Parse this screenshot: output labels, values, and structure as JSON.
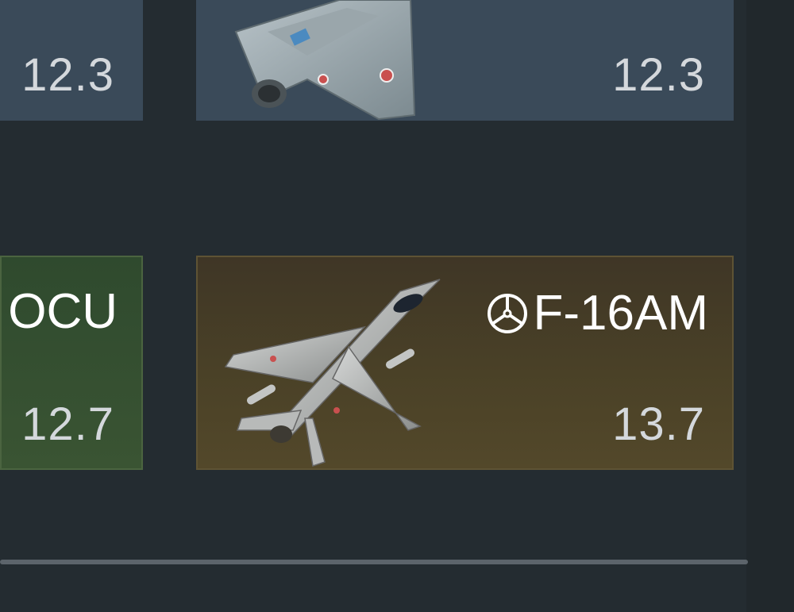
{
  "vehicles": [
    {
      "name": "",
      "br": "12.3",
      "type": "researchable"
    },
    {
      "name": "",
      "br": "12.3",
      "type": "researchable"
    },
    {
      "name": "OCU",
      "br": "12.7",
      "type": "squadron"
    },
    {
      "name": "F-16AM",
      "br": "13.7",
      "type": "premium",
      "badge_icon": "steering-wheel-icon"
    }
  ],
  "colors": {
    "background": "#242c31",
    "researchable_card": "#3a4a59",
    "squadron_card": "#3a5433",
    "premium_card": "#4a4127",
    "br_text": "#d4d8dc"
  }
}
